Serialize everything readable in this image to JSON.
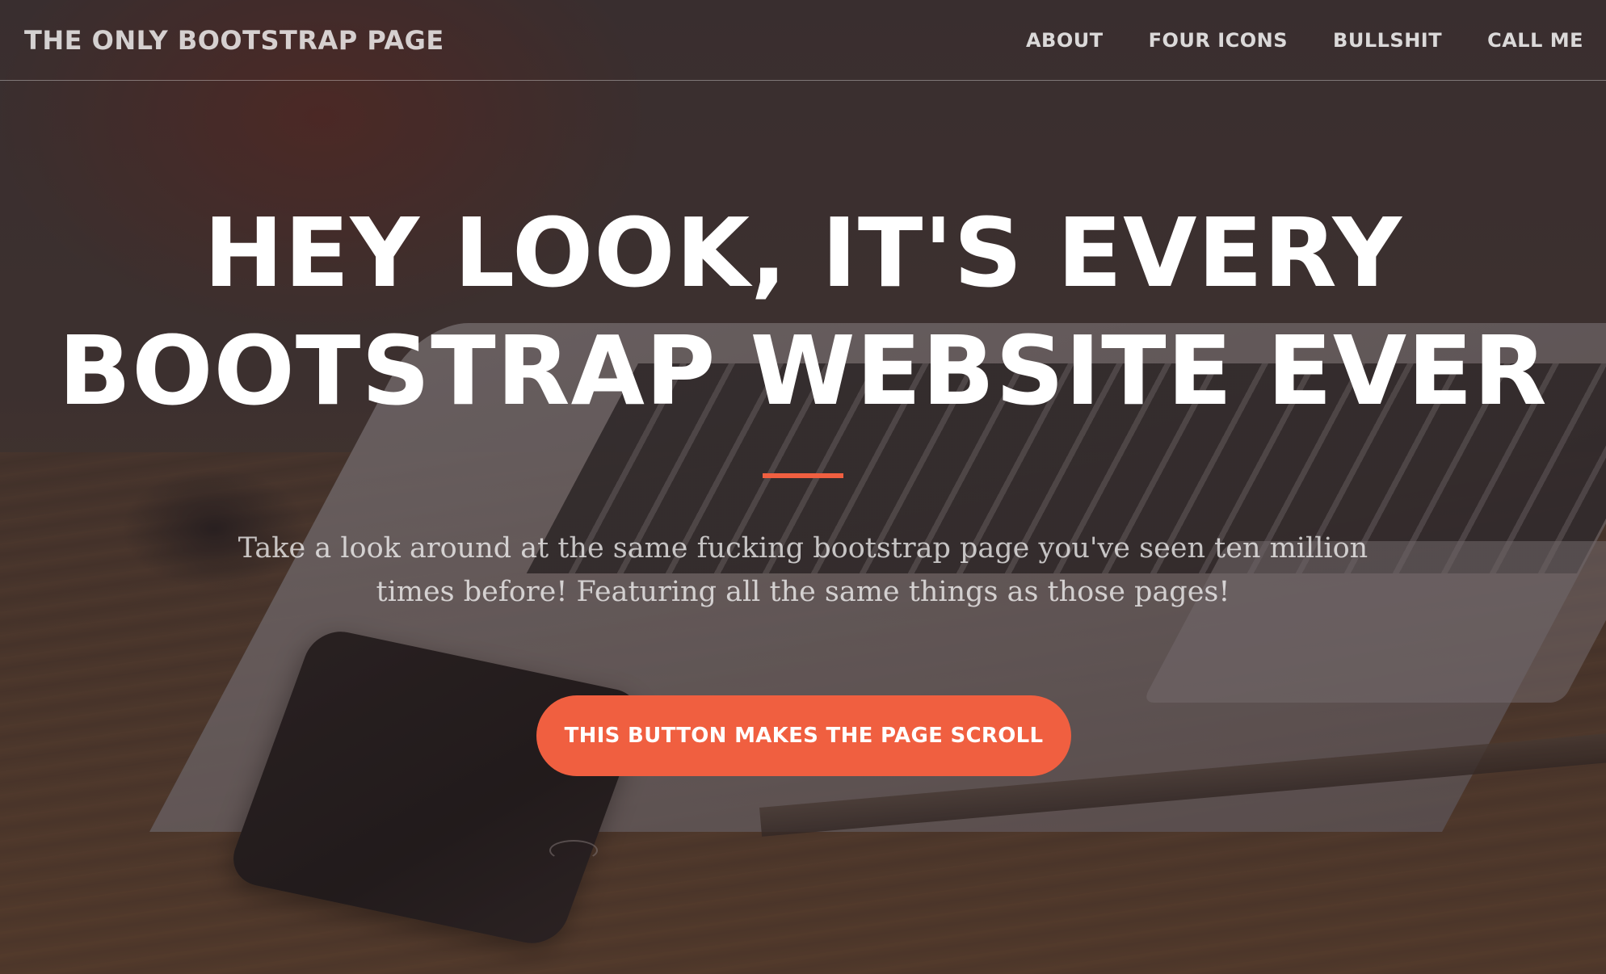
{
  "navbar": {
    "brand": "THE ONLY BOOTSTRAP PAGE",
    "links": [
      {
        "label": "ABOUT"
      },
      {
        "label": "FOUR ICONS"
      },
      {
        "label": "BULLSHIT"
      },
      {
        "label": "CALL ME"
      }
    ]
  },
  "hero": {
    "headline_line1": "HEY LOOK, IT'S EVERY",
    "headline_line2": "BOOTSTRAP WEBSITE EVER",
    "lead_line1": "Take a look around at the same fucking bootstrap page you've seen ten million",
    "lead_line2": "times before! Featuring all the same things as those pages!",
    "cta_label": "THIS BUTTON MAKES THE PAGE SCROLL"
  },
  "colors": {
    "accent": "#f05f40",
    "text": "#ffffff"
  }
}
